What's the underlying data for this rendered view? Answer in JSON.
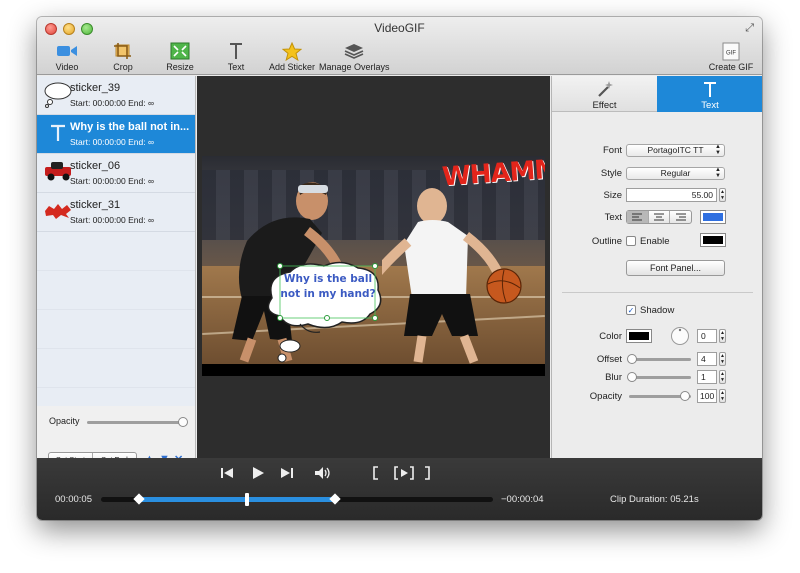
{
  "window": {
    "title": "VideoGIF"
  },
  "toolbar": {
    "video": "Video",
    "crop": "Crop",
    "resize": "Resize",
    "text": "Text",
    "add_sticker": "Add Sticker",
    "manage_overlays": "Manage Overlays",
    "create_gif": "Create GIF",
    "gif_badge": "GIF"
  },
  "stickers": [
    {
      "name": "sticker_39",
      "times": "Start: 00:00:00 End: ∞",
      "selected": false
    },
    {
      "name": "Why is the ball not in...",
      "times": "Start: 00:00:00 End: ∞",
      "selected": true
    },
    {
      "name": "sticker_06",
      "times": "Start: 00:00:00 End: ∞",
      "selected": false
    },
    {
      "name": "sticker_31",
      "times": "Start: 00:00:00 End: ∞",
      "selected": false
    }
  ],
  "list_controls": {
    "opacity_label": "Opacity",
    "opacity_value": 1.0,
    "set_start": "Set Start",
    "set_end": "Set End"
  },
  "preview": {
    "bubble_line1": "Why is the ball",
    "bubble_line2": "not in my hand?",
    "whamm": "WHAMM!"
  },
  "inspector": {
    "tabs": {
      "effect": "Effect",
      "text": "Text"
    },
    "font_label": "Font",
    "font_value": "PortagoITC TT",
    "style_label": "Style",
    "style_value": "Regular",
    "size_label": "Size",
    "size_value": "55.00",
    "text_label": "Text",
    "text_color": "#2f6fe0",
    "outline_label": "Outline",
    "outline_enable": "Enable",
    "outline_enabled": false,
    "outline_color": "#000000",
    "font_panel_button": "Font Panel...",
    "shadow_label": "Shadow",
    "shadow_enabled": true,
    "color_label": "Color",
    "shadow_color": "#000000",
    "angle_value": "0",
    "offset_label": "Offset",
    "offset_value": "4",
    "blur_label": "Blur",
    "blur_value": "1",
    "opacity_label": "Opacity",
    "opacity_value": "100"
  },
  "transport": {
    "current_time": "00:00:05",
    "remaining_time": "−00:00:04",
    "clip_duration": "Clip Duration: 05.21s",
    "progress_fraction": 0.55
  },
  "colors": {
    "accent": "#1e88d8",
    "whamm_red": "#e2251b",
    "bubble_text": "#3b5ac2"
  }
}
